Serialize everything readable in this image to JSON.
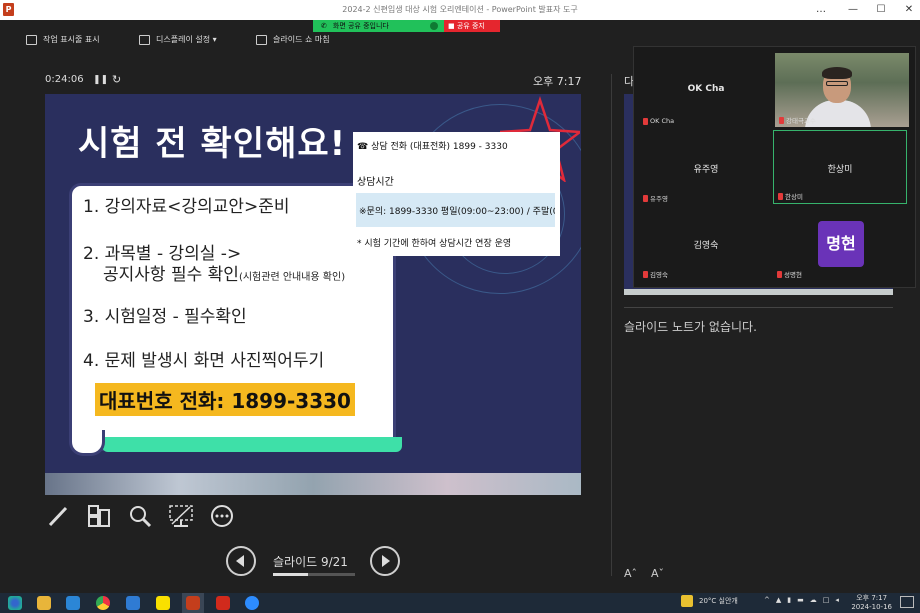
{
  "window": {
    "title": "2024-2 신편입생 대상 시험 오리엔테이션 - PowerPoint 발표자 도구",
    "app_icon": "P",
    "controls": [
      "…",
      "—",
      "☐",
      "✕"
    ]
  },
  "share": {
    "status": "화면 공유 중입니다",
    "stop": "공유 중지"
  },
  "toolbar": {
    "taskbar_show": "작업 표시줄 표시",
    "display_settings": "디스플레이 설정 ▾",
    "slideshow_end": "슬라이드 쇼 마침"
  },
  "presenter": {
    "elapsed": "0:24:06",
    "pause_glyph": "❚❚",
    "reset_glyph": "↻",
    "clock": "오후 7:17"
  },
  "slide": {
    "title": "시험 전 확인해요!",
    "items": [
      "1. 강의자료<강의교안>준비",
      "2. 과목별 - 강의실 ->",
      "공지사항 필수 확인",
      "(시험관련 안내내용 확인)",
      "3. 시험일정 - 필수확인",
      "4. 문제 발생시 화면 사진찍어두기"
    ],
    "hotline": "대표번호 전화: 1899-3330",
    "popup": {
      "phone": "☎ 상담 전화 (대표전화) 1899 - 3330",
      "hours_label": "상담시간",
      "hours": "※문의: 1899-3330  평일(09:00~23:00) / 주말(09:00~24:00)",
      "note": "* 시험 기간에 한하여 상담시간 연장 운영"
    }
  },
  "navigation": {
    "counter": "슬라이드 9/21",
    "progress": 0.43
  },
  "right_panel": {
    "next_label": "다",
    "notes": "슬라이드 노트가 없습니다.",
    "font_up": "Aˆ",
    "font_down": "Aˇ"
  },
  "zoom": {
    "tiles": [
      {
        "name": "OK Cha",
        "tag": "OK Cha"
      },
      {
        "name": "",
        "tag": "강태극교수"
      },
      {
        "name": "유주영",
        "tag": "유주영"
      },
      {
        "name": "한상미",
        "tag": "한상미"
      },
      {
        "name": "김영숙",
        "tag": "김영숙"
      },
      {
        "name": "명현",
        "tag": "성명현"
      }
    ]
  },
  "taskbar": {
    "weather": "20°C 실안개",
    "time": "오후 7:17",
    "date": "2024-10-16"
  },
  "colors": {
    "slide_bg": "#2a2f5e",
    "hotline_bg": "#f5b81f",
    "share_green": "#21c15a",
    "share_red": "#e5262e",
    "avatar_purple": "#6a33b8",
    "active_border": "#36b36c"
  }
}
